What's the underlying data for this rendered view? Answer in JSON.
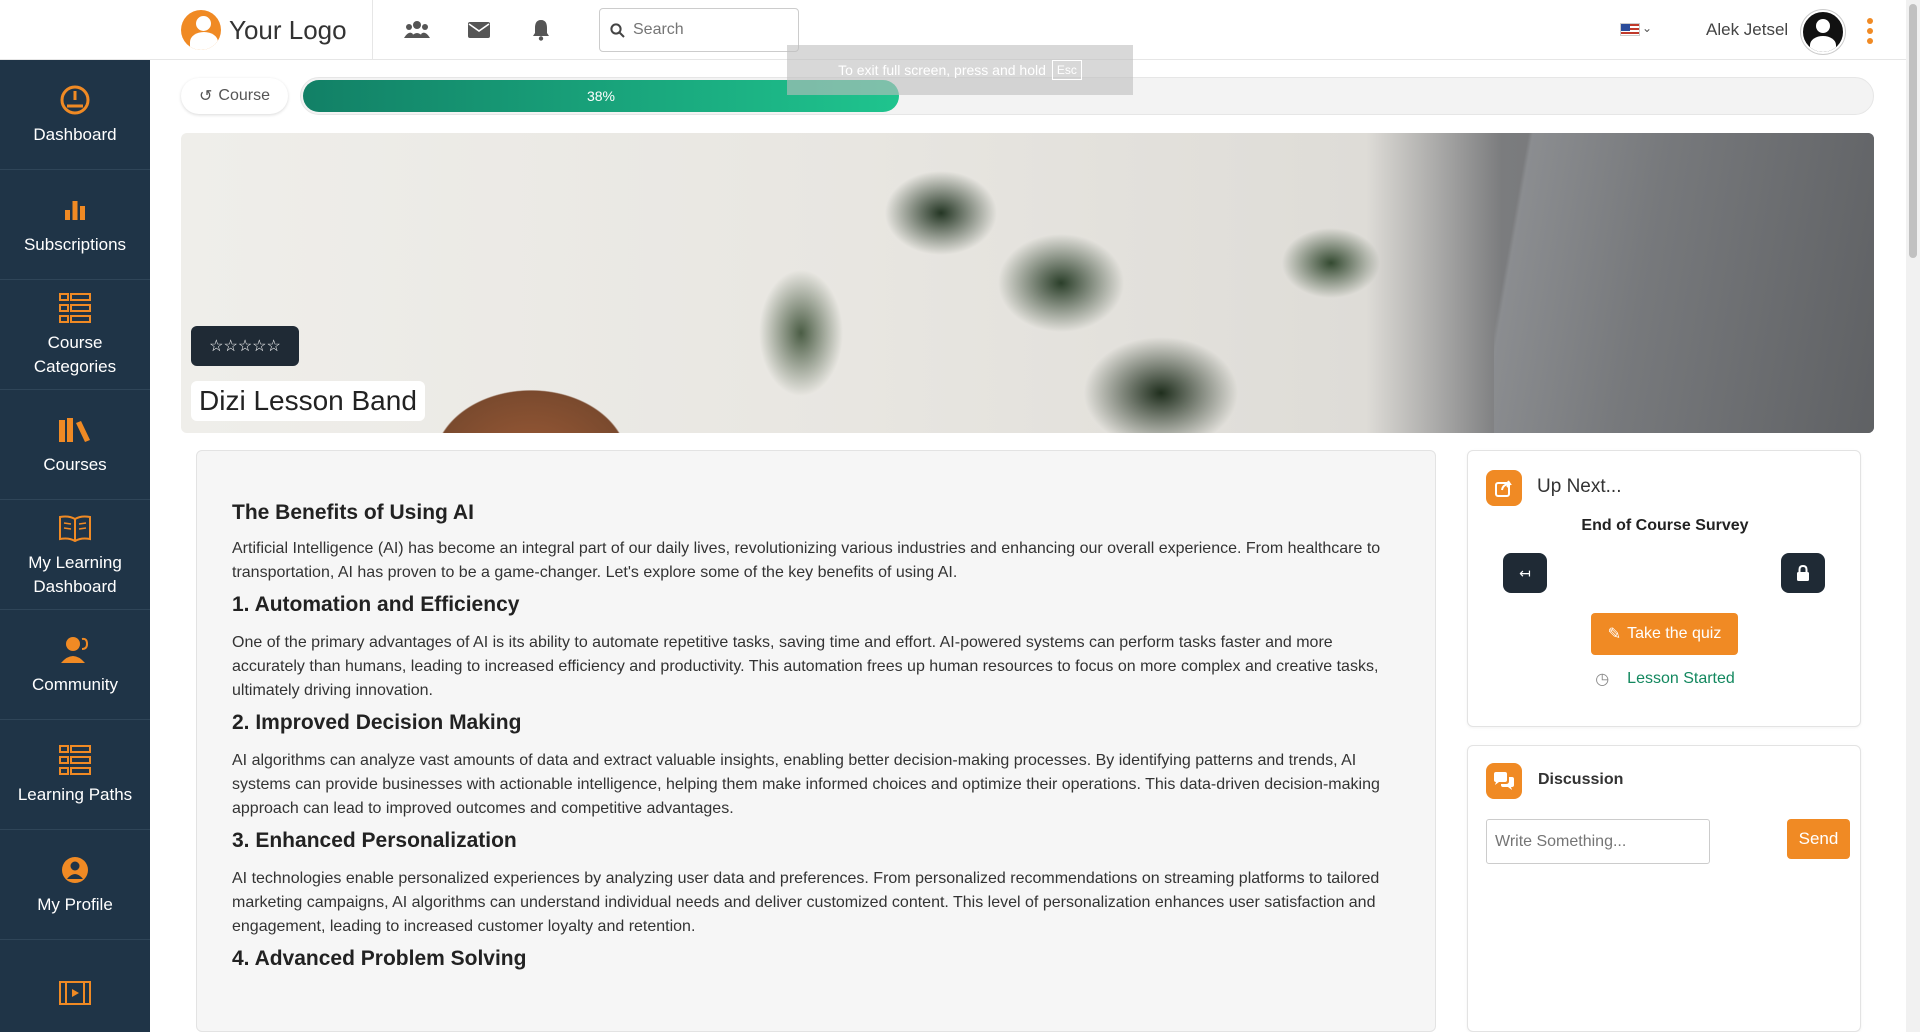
{
  "header": {
    "logo_text": "Your Logo",
    "search_placeholder": "Search",
    "user_name": "Alek Jetsel",
    "icons": [
      "users-icon",
      "mail-icon",
      "bell-icon",
      "search-icon",
      "flag-us-icon",
      "chevron-down-icon",
      "avatar",
      "kebab-menu-icon"
    ]
  },
  "fullscreen_toast": {
    "text": "To exit full screen, press and hold",
    "key": "Esc"
  },
  "sidebar": {
    "items": [
      {
        "label": "Dashboard",
        "icon": "gauge-icon"
      },
      {
        "label": "Subscriptions",
        "icon": "bar-chart-icon"
      },
      {
        "label": "Course Categories",
        "icon": "list-icon"
      },
      {
        "label": "Courses",
        "icon": "books-icon"
      },
      {
        "label": "My Learning Dashboard",
        "icon": "open-book-icon"
      },
      {
        "label": "Community",
        "icon": "community-icon"
      },
      {
        "label": "Learning Paths",
        "icon": "list-icon"
      },
      {
        "label": "My Profile",
        "icon": "user-circle-icon"
      }
    ]
  },
  "progress": {
    "back_label": "Course",
    "percent": 38,
    "percent_label": "38%"
  },
  "banner": {
    "title": "Dizi Lesson Band",
    "rating": 0,
    "stars": "☆☆☆☆☆"
  },
  "lesson": {
    "heading": "The Benefits of Using AI",
    "intro": "Artificial Intelligence (AI) has become an integral part of our daily lives, revolutionizing various industries and enhancing our overall experience. From healthcare to transportation, AI has proven to be a game-changer. Let's explore some of the key benefits of using AI.",
    "sections": [
      {
        "title": "1. Automation and Efficiency",
        "body": "One of the primary advantages of AI is its ability to automate repetitive tasks, saving time and effort. AI-powered systems can perform tasks faster and more accurately than humans, leading to increased efficiency and productivity. This automation frees up human resources to focus on more complex and creative tasks, ultimately driving innovation."
      },
      {
        "title": "2. Improved Decision Making",
        "body": "AI algorithms can analyze vast amounts of data and extract valuable insights, enabling better decision-making processes. By identifying patterns and trends, AI systems can provide businesses with actionable intelligence, helping them make informed choices and optimize their operations. This data-driven decision-making approach can lead to improved outcomes and competitive advantages."
      },
      {
        "title": "3. Enhanced Personalization",
        "body": "AI technologies enable personalized experiences by analyzing user data and preferences. From personalized recommendations on streaming platforms to tailored marketing campaigns, AI algorithms can understand individual needs and deliver customized content. This level of personalization enhances user satisfaction and engagement, leading to increased customer loyalty and retention."
      },
      {
        "title": "4. Advanced Problem Solving",
        "body": ""
      }
    ]
  },
  "up_next": {
    "title": "Up Next...",
    "item_title": "End of Course Survey",
    "prev_symbol": "↤",
    "lock_symbol": "🔒",
    "quiz_button": "Take the quiz",
    "status": "Lesson Started"
  },
  "discussion": {
    "title": "Discussion",
    "input_placeholder": "Write Something...",
    "send_button": "Send"
  },
  "colors": {
    "accent": "#f08a24",
    "sidebar_bg": "#1f3447",
    "progress_start": "#128066",
    "progress_end": "#1fc48e",
    "status_green": "#13885f"
  }
}
